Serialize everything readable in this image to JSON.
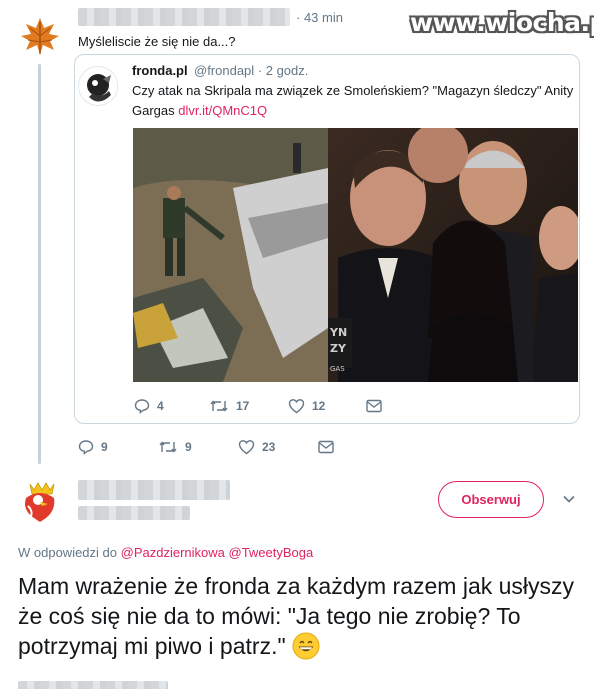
{
  "watermark": "www.wiocha.pl",
  "tweet1": {
    "time": "· 43 min",
    "text": "Myśleliscie że się nie da...?",
    "actions": {
      "reply_count": "9",
      "retweet_count": "9",
      "like_count": "23"
    }
  },
  "quote": {
    "name": "fronda.pl",
    "handle": "@frondapl · 2 godz.",
    "text": "Czy atak na Skripala ma związek ze Smoleńskiem? \"Magazyn śledczy\" Anity Gargas",
    "link": "dlvr.it/QMnC1Q",
    "actions": {
      "reply_count": "4",
      "retweet_count": "17",
      "like_count": "12"
    }
  },
  "tweet2": {
    "follow_label": "Obserwuj",
    "reply_prefix": "W odpowiedzi do",
    "mention_1": "@Pazdziernikowa",
    "mention_2": "@TweetyBoga",
    "text": "Mam wrażenie że fronda za każdym razem jak usłyszy że coś się nie da to mówi: \"Ja tego nie zrobię? To potrzymaj mi piwo i patrz.\""
  },
  "colors": {
    "accent": "#e0245e",
    "muted": "#657786",
    "border": "#ccd6dd"
  },
  "icons": [
    "leaf-avatar",
    "eagle-crest-avatar",
    "reply-icon",
    "retweet-icon",
    "like-icon",
    "envelope-icon",
    "chevron-down-icon",
    "grinning-emoji"
  ]
}
